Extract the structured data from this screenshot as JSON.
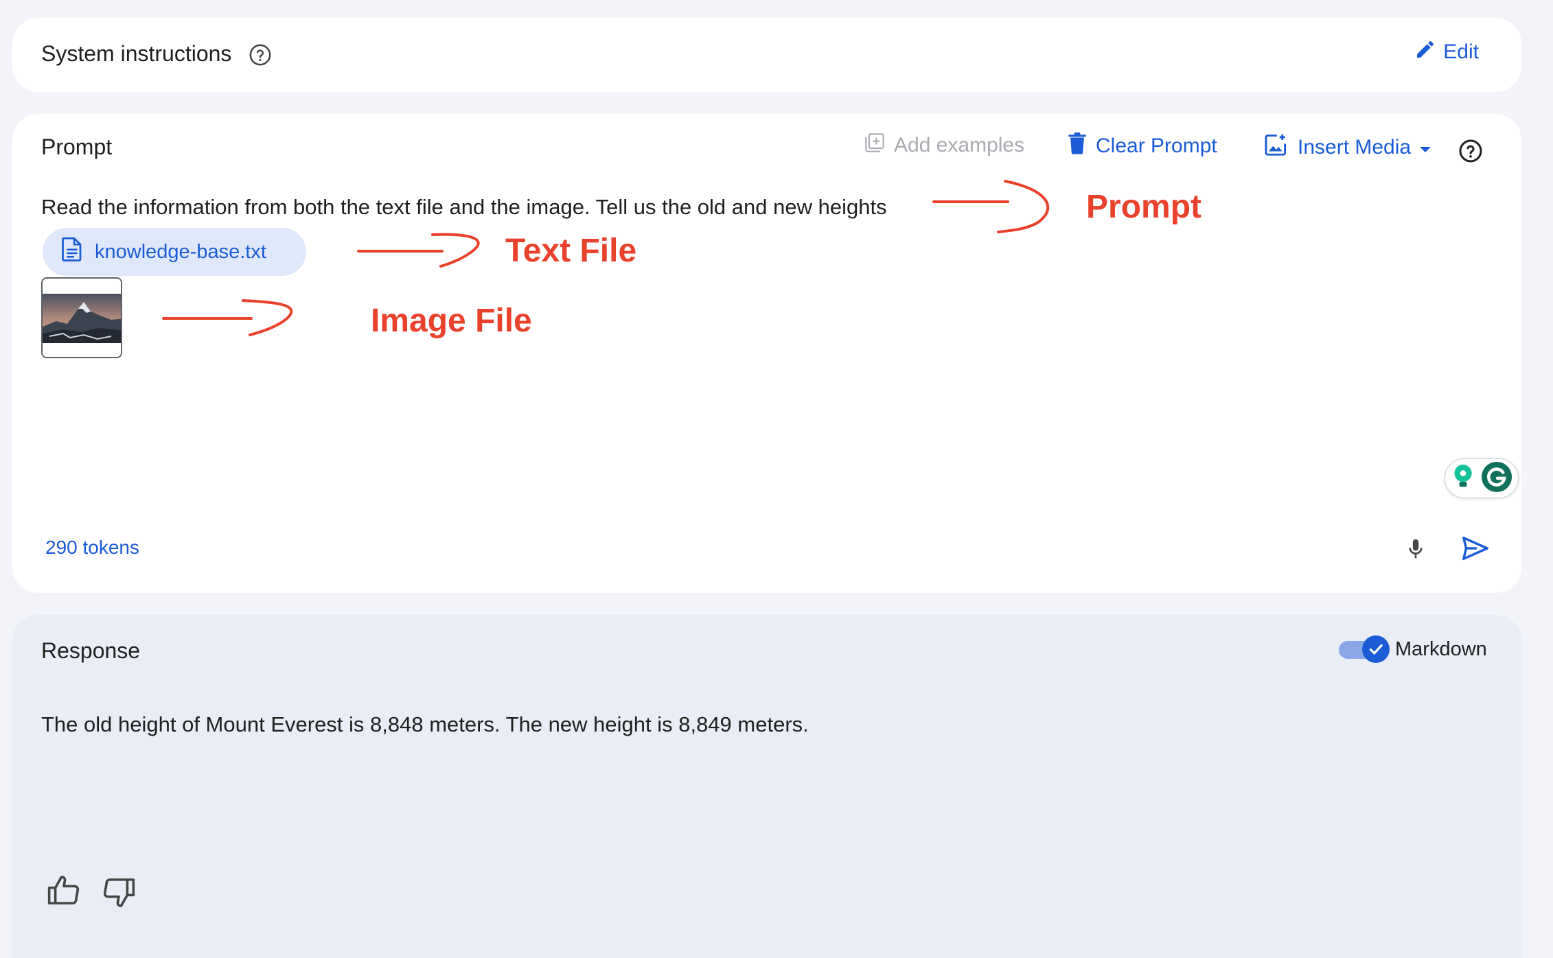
{
  "system_instructions": {
    "title": "System instructions",
    "edit_label": "Edit",
    "icons": [
      "help-circle-icon",
      "pencil-icon"
    ]
  },
  "prompt": {
    "title": "Prompt",
    "toolbar": {
      "add_examples_label": "Add examples",
      "clear_prompt_label": "Clear Prompt",
      "insert_media_label": "Insert Media"
    },
    "text": "Read the information from both the text file and the image. Tell us the old and new heights",
    "attachment": {
      "file_name": "knowledge-base.txt",
      "file_icon": "document-icon",
      "image_icon": "mountain-image-thumbnail"
    },
    "token_count": "290 tokens",
    "annotations": {
      "prompt_label": "Prompt",
      "text_file_label": "Text File",
      "image_file_label": "Image File",
      "color": "#e8412c"
    }
  },
  "response": {
    "title": "Response",
    "markdown_label": "Markdown",
    "markdown_enabled": true,
    "text": "The old height of Mount Everest is 8,848 meters. The new height is 8,849 meters."
  },
  "colors": {
    "accent": "#1a5bd6",
    "background": "#f2f4f9",
    "response_background": "#e9edf5",
    "disabled": "#a8abb0"
  }
}
